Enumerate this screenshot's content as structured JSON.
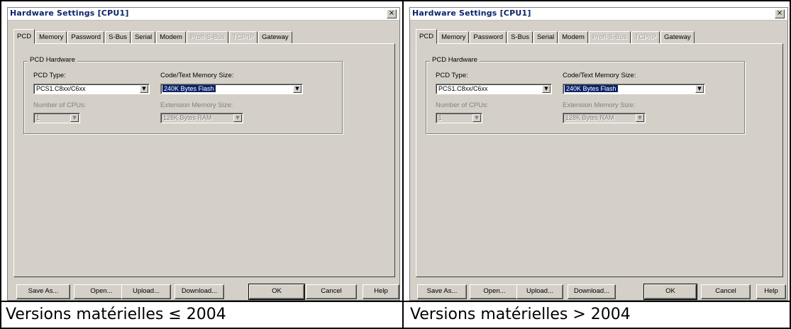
{
  "panels": [
    {
      "title": "Hardware Settings [CPU1]",
      "close": "×",
      "tabs": [
        "PCD",
        "Memory",
        "Password",
        "S-Bus",
        "Serial",
        "Modem",
        "Profi-S-Bus",
        "TCP/IP",
        "Gateway"
      ],
      "group_label": "PCD Hardware",
      "pcd_type_label": "PCD Type:",
      "pcd_type_value": "PCS1.C8xx/C6xx",
      "code_mem_label": "Code/Text Memory Size:",
      "code_mem_value": "240K Bytes Flash",
      "num_cpus_label": "Number of CPUs:",
      "num_cpus_value": "1",
      "ext_mem_label": "Extension Memory Size:",
      "ext_mem_value": "128K Bytes RAM",
      "buttons": {
        "save_as": "Save As...",
        "open": "Open...",
        "upload": "Upload...",
        "download": "Download...",
        "ok": "OK",
        "cancel": "Cancel",
        "help": "Help"
      },
      "caption": "Versions matérielles ≤ 2004"
    },
    {
      "title": "Hardware Settings [CPU1]",
      "close": "×",
      "tabs": [
        "PCD",
        "Memory",
        "Password",
        "S-Bus",
        "Serial",
        "Modem",
        "Profi-S-Bus",
        "TCP/IP",
        "Gateway"
      ],
      "group_label": "PCD Hardware",
      "pcd_type_label": "PCD Type:",
      "pcd_type_value": "PCS1.C8xx/C6xx",
      "code_mem_label": "Code/Text Memory Size:",
      "code_mem_value": "240K Bytes Flash",
      "num_cpus_label": "Number of CPUs:",
      "num_cpus_value": "1",
      "ext_mem_label": "Extension Memory Size:",
      "ext_mem_value": "128K Bytes RAM",
      "buttons": {
        "save_as": "Save As...",
        "open": "Open...",
        "upload": "Upload...",
        "download": "Download...",
        "ok": "OK",
        "cancel": "Cancel",
        "help": "Help"
      },
      "caption": "Versions matérielles > 2004"
    }
  ],
  "icons": {
    "dropdown": "chevron-down-icon",
    "close": "close-icon"
  },
  "colors": {
    "dialog_bg": "#d4d0c8",
    "title_text": "#0a246a",
    "selection": "#0a246a"
  }
}
